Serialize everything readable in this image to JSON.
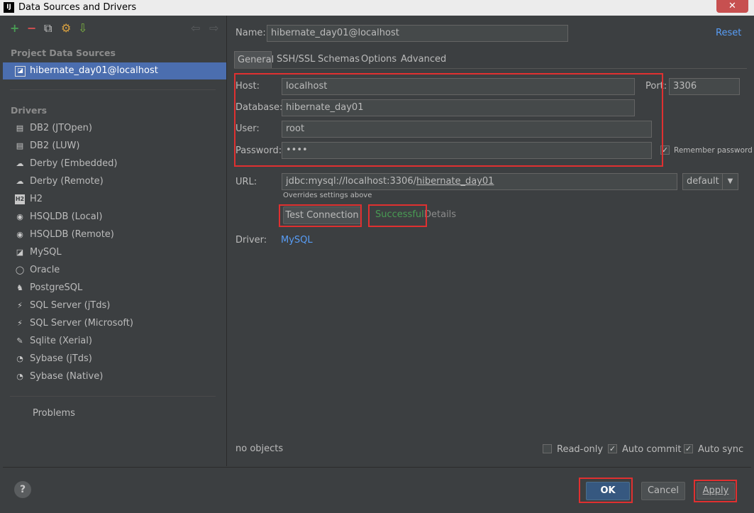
{
  "window": {
    "title": "Data Sources and Drivers",
    "app_icon": "IJ"
  },
  "toolbar": {
    "add": "+",
    "remove": "−",
    "copy": "⧉",
    "settings": "⚙",
    "import": "⇩",
    "back": "⇦",
    "forward": "⇨"
  },
  "sidebar": {
    "project_label": "Project Data Sources",
    "selected_source": "hibernate_day01@localhost",
    "drivers_label": "Drivers",
    "drivers": [
      {
        "label": "DB2 (JTOpen)",
        "icon": "ibm-db2-icon",
        "glyph": "▤"
      },
      {
        "label": "DB2 (LUW)",
        "icon": "ibm-db2-icon",
        "glyph": "▤"
      },
      {
        "label": "Derby (Embedded)",
        "icon": "derby-icon",
        "glyph": "☁"
      },
      {
        "label": "Derby (Remote)",
        "icon": "derby-icon",
        "glyph": "☁"
      },
      {
        "label": "H2",
        "icon": "h2-icon",
        "glyph": "H2"
      },
      {
        "label": "HSQLDB (Local)",
        "icon": "hsqldb-icon",
        "glyph": "◉"
      },
      {
        "label": "HSQLDB (Remote)",
        "icon": "hsqldb-icon",
        "glyph": "◉"
      },
      {
        "label": "MySQL",
        "icon": "mysql-icon",
        "glyph": "◪"
      },
      {
        "label": "Oracle",
        "icon": "oracle-icon",
        "glyph": "◯"
      },
      {
        "label": "PostgreSQL",
        "icon": "postgresql-icon",
        "glyph": "♞"
      },
      {
        "label": "SQL Server (jTds)",
        "icon": "sqlserver-icon",
        "glyph": "⚡"
      },
      {
        "label": "SQL Server (Microsoft)",
        "icon": "sqlserver-icon",
        "glyph": "⚡"
      },
      {
        "label": "Sqlite (Xerial)",
        "icon": "sqlite-icon",
        "glyph": "✎"
      },
      {
        "label": "Sybase (jTds)",
        "icon": "sybase-icon",
        "glyph": "◔"
      },
      {
        "label": "Sybase (Native)",
        "icon": "sybase-icon",
        "glyph": "◔"
      }
    ],
    "problems_label": "Problems"
  },
  "form": {
    "name_label": "Name:",
    "name_value": "hibernate_day01@localhost",
    "reset_label": "Reset",
    "tabs": [
      "General",
      "SSH/SSL",
      "Schemas",
      "Options",
      "Advanced"
    ],
    "host_label": "Host:",
    "host_value": "localhost",
    "port_label": "Port:",
    "port_value": "3306",
    "database_label": "Database:",
    "database_value": "hibernate_day01",
    "user_label": "User:",
    "user_value": "root",
    "password_label": "Password:",
    "password_value": "••••",
    "remember_password_label": "Remember password",
    "url_label": "URL:",
    "url_prefix": "jdbc:mysql://localhost:3306/",
    "url_db": "hibernate_day01",
    "url_mode": "default",
    "overrides_note": "Overrides settings above",
    "test_connection_label": "Test Connection",
    "test_status": "Successful",
    "details_label": "Details",
    "driver_label": "Driver:",
    "driver_value": "MySQL",
    "objects_status": "no objects",
    "readonly_label": "Read-only",
    "autocommit_label": "Auto commit",
    "autosync_label": "Auto sync"
  },
  "buttons": {
    "ok": "OK",
    "cancel": "Cancel",
    "apply": "Apply",
    "help": "?"
  },
  "colors": {
    "background": "#3c3f41",
    "selection": "#4b6eaf",
    "success": "#499c54",
    "link": "#589df6",
    "highlight_box": "#e03030"
  }
}
